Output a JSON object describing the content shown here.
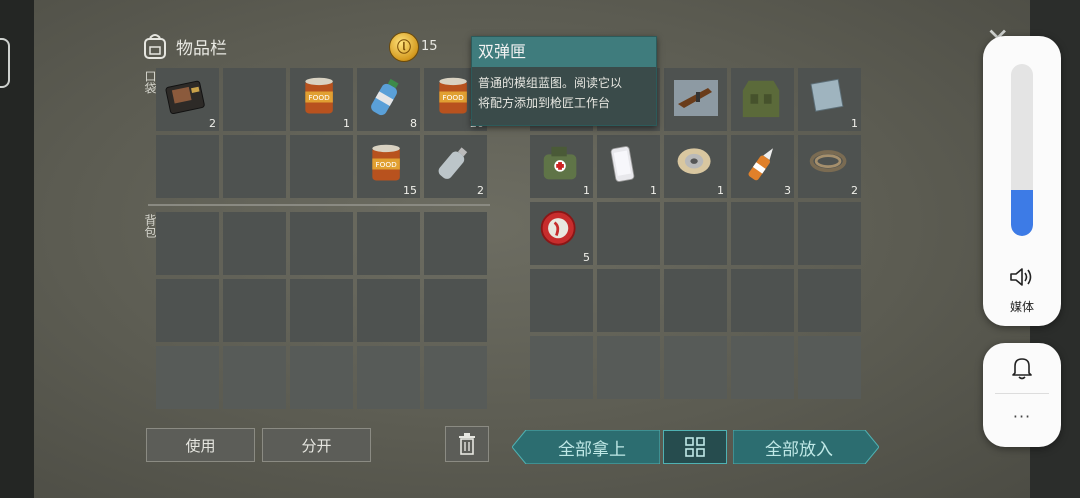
{
  "inventory": {
    "title": "物品栏",
    "coins": "15",
    "pockets_label": "口袋",
    "backpack_label": "背包"
  },
  "pocket_items": [
    {
      "name": "wallet",
      "count": "2"
    },
    {
      "name": "empty",
      "count": ""
    },
    {
      "name": "canned-food",
      "count": "1"
    },
    {
      "name": "water-bottle",
      "count": "8"
    },
    {
      "name": "canned-food",
      "count": "20"
    },
    {
      "name": "empty",
      "count": ""
    },
    {
      "name": "empty",
      "count": ""
    },
    {
      "name": "empty",
      "count": ""
    },
    {
      "name": "canned-food",
      "count": "15"
    },
    {
      "name": "empty-bottle",
      "count": "2"
    }
  ],
  "storage_items": [
    {
      "name": "hidden",
      "count": ""
    },
    {
      "name": "hidden",
      "count": ""
    },
    {
      "name": "rifle-blueprint",
      "count": ""
    },
    {
      "name": "military-vest",
      "count": ""
    },
    {
      "name": "metal-plate",
      "count": "1"
    },
    {
      "name": "medkit-bag",
      "count": "1"
    },
    {
      "name": "smartphone",
      "count": "1"
    },
    {
      "name": "wire-spool",
      "count": "1"
    },
    {
      "name": "glue",
      "count": "3"
    },
    {
      "name": "wire-coil",
      "count": "2"
    },
    {
      "name": "bottle-cap",
      "count": "5"
    }
  ],
  "tooltip": {
    "title": "双弹匣",
    "description_line1": "普通的模组蓝图。阅读它以",
    "description_line2": "将配方添加到枪匠工作台"
  },
  "buttons": {
    "use": "使用",
    "split": "分开",
    "take_all": "全部拿上",
    "put_all": "全部放入"
  },
  "system": {
    "volume_label": "媒体",
    "more": "···",
    "volume_level": 0.27
  },
  "colors": {
    "accent_teal": "#2c6d70",
    "volume_blue": "#3d7be6"
  }
}
